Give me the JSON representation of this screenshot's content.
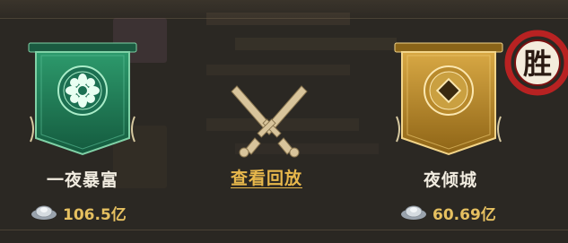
{
  "match": {
    "left_team": {
      "name": "一夜暴富",
      "power": "106.5亿"
    },
    "right_team": {
      "name": "夜倾城",
      "power": "60.69亿"
    },
    "replay_label": "查看回放",
    "result_badge": "胜"
  },
  "colors": {
    "left_banner": "#1f7a56",
    "right_banner": "#b98a2c",
    "gold_text": "#e6c060",
    "replay_text": "#e8b84c",
    "badge_red": "#b82222"
  },
  "icons": [
    "silver-ingot-icon",
    "lotus-emblem-icon",
    "coin-emblem-icon",
    "crossed-swords-icon",
    "victory-seal-icon"
  ]
}
